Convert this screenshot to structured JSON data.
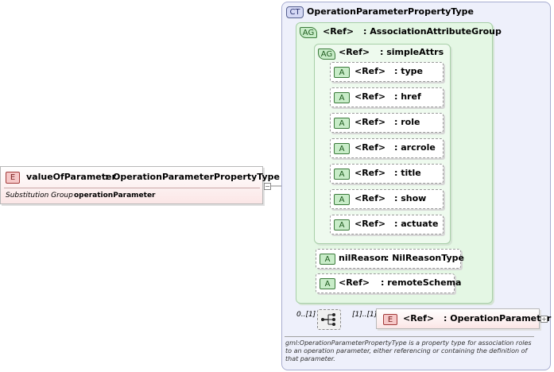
{
  "element": {
    "badge": "E",
    "name": "valueOfParameter",
    "sep": ":",
    "type": "OperationParameterPropertyType",
    "subst_label": "Substitution Group",
    "subst_value": "operationParameter"
  },
  "complex_type": {
    "badge": "CT",
    "name": "OperationParameterPropertyType"
  },
  "assoc_group": {
    "badge": "AG",
    "ref": "<Ref>",
    "name": ": AssociationAttributeGroup"
  },
  "simple_attrs": {
    "badge": "AG",
    "ref": "<Ref>",
    "name": ": simpleAttrs"
  },
  "attributes": [
    {
      "badge": "A",
      "ref": "<Ref>",
      "name": ": type"
    },
    {
      "badge": "A",
      "ref": "<Ref>",
      "name": ": href"
    },
    {
      "badge": "A",
      "ref": "<Ref>",
      "name": ": role"
    },
    {
      "badge": "A",
      "ref": "<Ref>",
      "name": ": arcrole"
    },
    {
      "badge": "A",
      "ref": "<Ref>",
      "name": ": title"
    },
    {
      "badge": "A",
      "ref": "<Ref>",
      "name": ": show"
    },
    {
      "badge": "A",
      "ref": "<Ref>",
      "name": ": actuate"
    }
  ],
  "nil_reason": {
    "badge": "A",
    "name": "nilReason",
    "type": ": NilReasonType"
  },
  "remote_schema": {
    "badge": "A",
    "ref": "<Ref>",
    "name": ": remoteSchema"
  },
  "sequence": {
    "cardinality_left": "0..[1]",
    "cardinality_right": "[1]..[1]"
  },
  "child_element": {
    "badge": "E",
    "ref": "<Ref>",
    "name": ": OperationParameter"
  },
  "documentation": "gml:OperationParameterPropertyType is a property type for association roles to an operation parameter, either referencing or containing the definition of that parameter."
}
